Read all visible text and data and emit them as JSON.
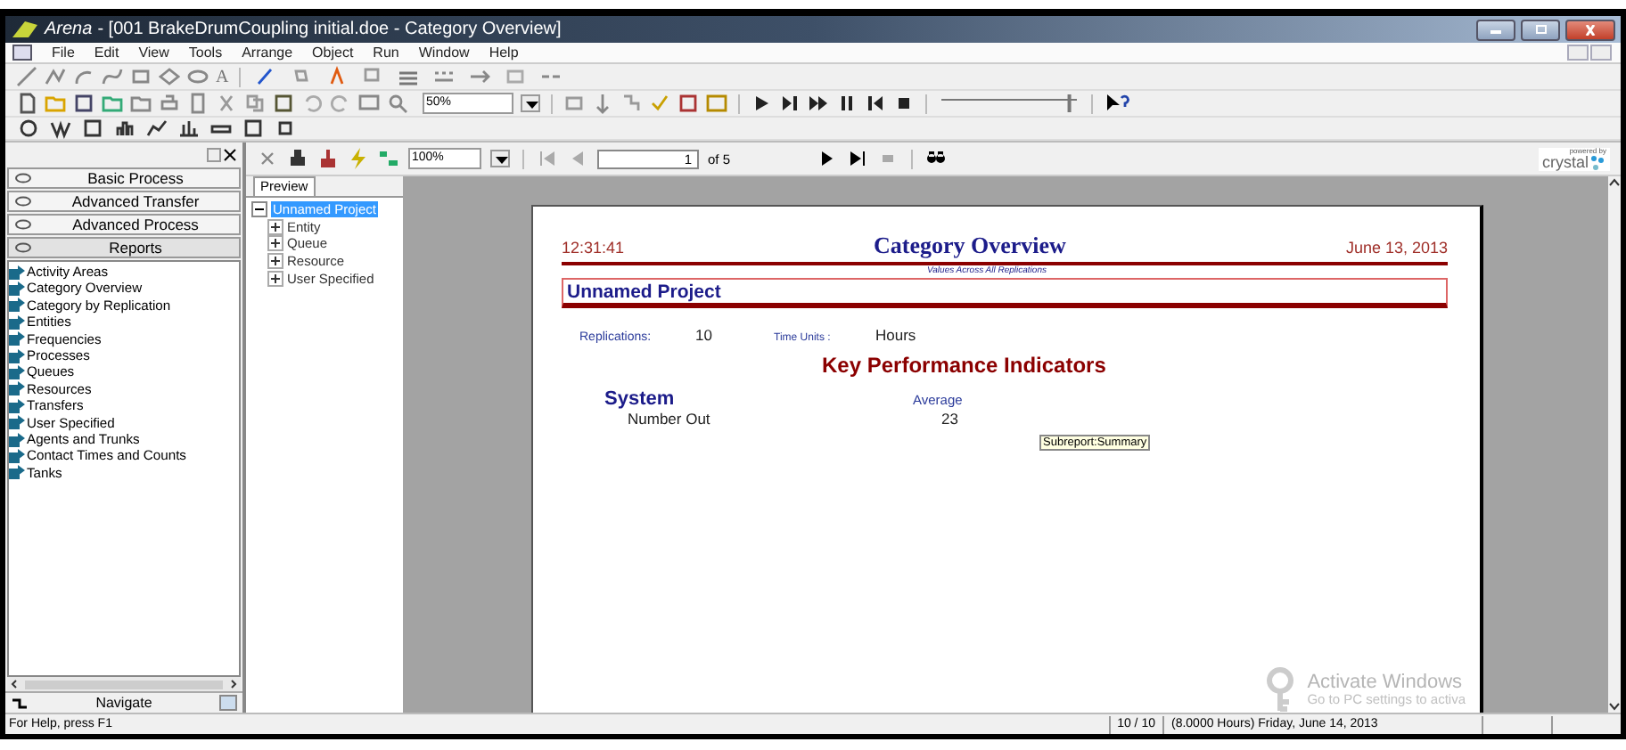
{
  "window": {
    "app": "Arena",
    "title": " - [001 BrakeDrumCoupling initial.doe - Category Overview]"
  },
  "menu": [
    "File",
    "Edit",
    "View",
    "Tools",
    "Arrange",
    "Object",
    "Run",
    "Window",
    "Help"
  ],
  "toolbar": {
    "text_tool": "A",
    "zoom": "50%",
    "speed": {
      "level": 0.97
    }
  },
  "panels": [
    {
      "label": "Basic Process",
      "selected": false
    },
    {
      "label": "Advanced Transfer",
      "selected": false
    },
    {
      "label": "Advanced Process",
      "selected": false
    },
    {
      "label": "Reports",
      "selected": true
    }
  ],
  "reports": [
    "Activity Areas",
    "Category Overview",
    "Category by Replication",
    "Entities",
    "Frequencies",
    "Processes",
    "Queues",
    "Resources",
    "Transfers",
    "User Specified",
    "Agents and Trunks",
    "Contact Times and Counts",
    "Tanks"
  ],
  "navigate": "Navigate",
  "report_toolbar": {
    "zoom": "100%",
    "page": "1",
    "of": "of 5"
  },
  "logo": {
    "powered": "powered by",
    "name": "crystal"
  },
  "preview_tab": {
    "label": "Preview",
    "selected": true
  },
  "tree": {
    "label": "Unnamed Project",
    "selected": true,
    "expanded": true,
    "children": [
      {
        "label": "Entity",
        "expanded": false
      },
      {
        "label": "Queue",
        "expanded": false
      },
      {
        "label": "Resource",
        "expanded": false
      },
      {
        "label": "User Specified",
        "expanded": false
      }
    ]
  },
  "report": {
    "time": "12:31:41",
    "title": "Category Overview",
    "subtitle": "Values Across All Replications",
    "date": "June 13, 2013",
    "project": "Unnamed Project",
    "replications_label": "Replications:",
    "replications": "10",
    "time_units_label": "Time Units :",
    "time_units": "Hours",
    "heading": "Key Performance Indicators",
    "section": "System",
    "column": "Average",
    "row_label": "Number Out",
    "row_value": "23",
    "tooltip": "Subreport:Summary"
  },
  "os_notice": {
    "title": "Activate Windows",
    "text": "Go to PC settings to activa"
  },
  "status_bar": {
    "help": "For Help, press F1",
    "count": "10 / 10",
    "time": "(8.0000 Hours) Friday, June 14, 2013"
  }
}
